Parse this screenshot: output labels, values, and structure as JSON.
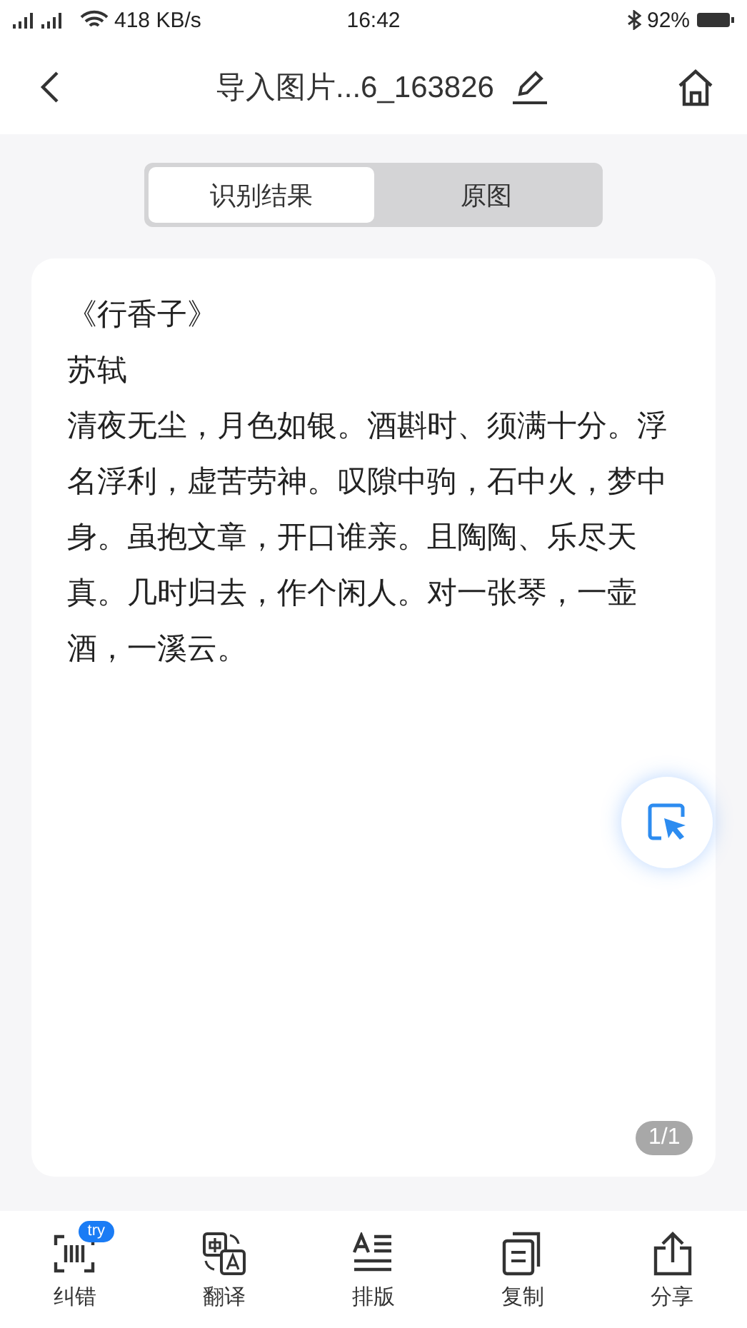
{
  "status_bar": {
    "network_speed": "418 KB/s",
    "time": "16:42",
    "battery": "92%"
  },
  "header": {
    "title": "导入图片...6_163826"
  },
  "tabs": [
    {
      "label": "识别结果",
      "selected": true
    },
    {
      "label": "原图",
      "selected": false
    }
  ],
  "result": {
    "title": "《行香子》",
    "author": "苏轼",
    "body": "清夜无尘，月色如银。酒斟时、须满十分。浮名浮利，虚苦劳神。叹隙中驹，石中火，梦中身。虽抱文章，开口谁亲。且陶陶、乐尽天真。几时归去，作个闲人。对一张琴，一壶酒，一溪云。",
    "page": "1/1"
  },
  "toolbar": [
    {
      "kind": "correct",
      "label": "纠错",
      "badge": "try"
    },
    {
      "kind": "translate",
      "label": "翻译"
    },
    {
      "kind": "layout",
      "label": "排版"
    },
    {
      "kind": "copy",
      "label": "复制"
    },
    {
      "kind": "share",
      "label": "分享"
    }
  ]
}
